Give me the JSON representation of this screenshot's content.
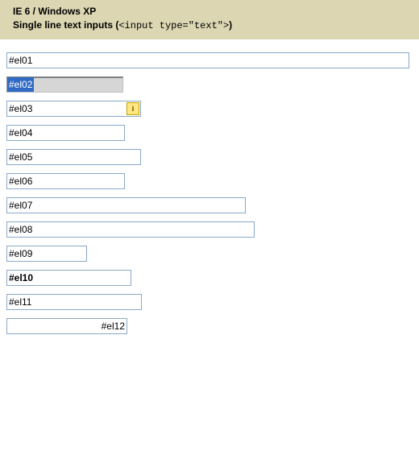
{
  "header": {
    "title": "IE 6 / Windows XP",
    "subtitle_prefix": "Single line text inputs (",
    "subtitle_code": "<input type=\"text\">",
    "subtitle_suffix": ")"
  },
  "inputs": {
    "el01": "#el01",
    "el02": "#el02",
    "el03": "#el03",
    "el04": "#el04",
    "el05": "#el05",
    "el06": "#el06",
    "el07": "#el07",
    "el08": "#el08",
    "el09": "#el09",
    "el10": "#el10",
    "el11": "#el11",
    "el12": "#el12"
  },
  "icons": {
    "autocomplete_glyph": "i"
  }
}
